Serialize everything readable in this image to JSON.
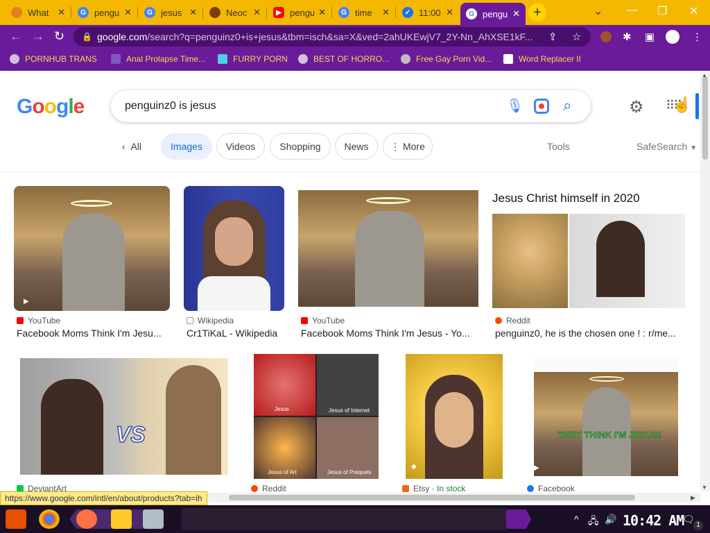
{
  "tabs": [
    {
      "title": "What",
      "favicon_color": "#e67e22"
    },
    {
      "title": "pengu",
      "favicon_color": "#4285f4"
    },
    {
      "title": "jesus",
      "favicon_color": "#4285f4"
    },
    {
      "title": "Neoc",
      "favicon_color": "#7b3f00"
    },
    {
      "title": "pengu",
      "favicon_color": "#ff0000"
    },
    {
      "title": "time",
      "favicon_color": "#4285f4"
    },
    {
      "title": "11:00",
      "favicon_color": "#1a73e8"
    },
    {
      "title": "pengu",
      "favicon_color": "#4285f4"
    }
  ],
  "address": {
    "host": "google.com",
    "rest": "/search?q=penguinz0+is+jesus&tbm=isch&sa=X&ved=2ahUKEwjV7_2Y-Nn_AhXSE1kF..."
  },
  "bookmarks": [
    "PORNHUB TRANS",
    "Anal Prolapse Time...",
    "FURRY PORN",
    "BEST OF HORRO...",
    "Free Gay Porn Vid...",
    "Word Replacer II"
  ],
  "search": {
    "query": "penguinz0 is jesus"
  },
  "filters": {
    "all": "All",
    "chips": [
      "Images",
      "Videos",
      "Shopping",
      "News",
      "More"
    ],
    "selected": "Images",
    "tools": "Tools",
    "safesearch": "SafeSearch"
  },
  "results": [
    {
      "source": "YouTube",
      "title": "Facebook Moms Think I'm Jesu...",
      "source_color": "#ff0000"
    },
    {
      "source": "Wikipedia",
      "title": "Cr1TiKaL - Wikipedia",
      "source_color": "#202124"
    },
    {
      "source": "YouTube",
      "title": "Facebook Moms Think I'm Jesus - Yo...",
      "source_color": "#ff0000"
    },
    {
      "source": "Reddit",
      "title": "penguinz0, he is the chosen one ! : r/me...",
      "source_color": "#ff4500",
      "overlay": "Jesus Christ himself in 2020"
    },
    {
      "source": "DeviantArt",
      "title": "",
      "source_color": "#05cc47",
      "overlay": "VS"
    },
    {
      "source": "Reddit",
      "title": "",
      "source_color": "#ff4500",
      "grid_labels": [
        "Jesus",
        "Jesus of Internet",
        "Jesus of Art",
        "Jesus of Prequels"
      ]
    },
    {
      "source": "Etsy",
      "stock": "In stock",
      "title": "",
      "source_color": "#f1641e"
    },
    {
      "source": "Facebook",
      "title": "",
      "source_color": "#1877f2",
      "overlay": "THEY THINK I'M JESUS!"
    }
  ],
  "status_url": "https://www.google.com/intl/en/about/products?tab=ih",
  "taskbar": {
    "clock": "10:42 AM",
    "notifications": "1"
  },
  "colors": {
    "tabstrip": "#f5b800",
    "toolbar": "#6a1b9a",
    "bookmark_text": "#ffd54f",
    "chip_selected": "#e8f0fe"
  }
}
